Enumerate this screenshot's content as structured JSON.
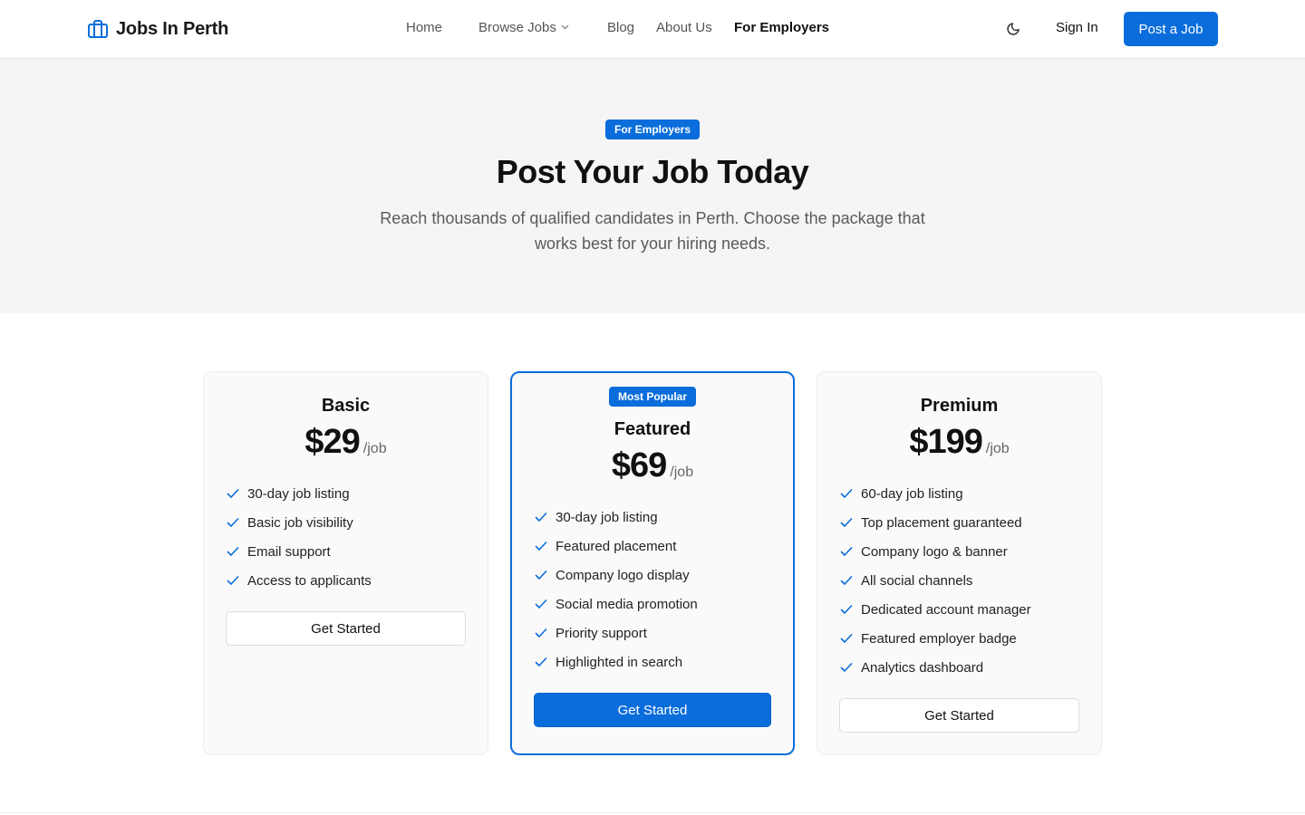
{
  "header": {
    "brand": "Jobs In Perth",
    "nav": [
      "Home",
      "Browse Jobs",
      "Blog",
      "About Us",
      "For Employers"
    ],
    "active_nav": "For Employers",
    "sign_in": "Sign In",
    "post_job": "Post a Job"
  },
  "hero": {
    "badge": "For Employers",
    "title": "Post Your Job Today",
    "subtitle": "Reach thousands of qualified candidates in Perth. Choose the package that works best for your hiring needs."
  },
  "plans": [
    {
      "name": "Basic",
      "price": "$29",
      "per": "/job",
      "features": [
        "30-day job listing",
        "Basic job visibility",
        "Email support",
        "Access to applicants"
      ],
      "cta": "Get Started"
    },
    {
      "badge": "Most Popular",
      "name": "Featured",
      "price": "$69",
      "per": "/job",
      "features": [
        "30-day job listing",
        "Featured placement",
        "Company logo display",
        "Social media promotion",
        "Priority support",
        "Highlighted in search"
      ],
      "cta": "Get Started"
    },
    {
      "name": "Premium",
      "price": "$199",
      "per": "/job",
      "features": [
        "60-day job listing",
        "Top placement guaranteed",
        "Company logo & banner",
        "All social channels",
        "Dedicated account manager",
        "Featured employer badge",
        "Analytics dashboard"
      ],
      "cta": "Get Started"
    }
  ],
  "colors": {
    "accent": "#0a6ddb",
    "hero_bg": "#f5f5f5",
    "card_bg": "#fafafa"
  },
  "icons": {
    "logo": "briefcase-icon",
    "theme": "moon-icon",
    "nav_dropdown": "chevron-down-icon",
    "feature": "check-icon"
  }
}
